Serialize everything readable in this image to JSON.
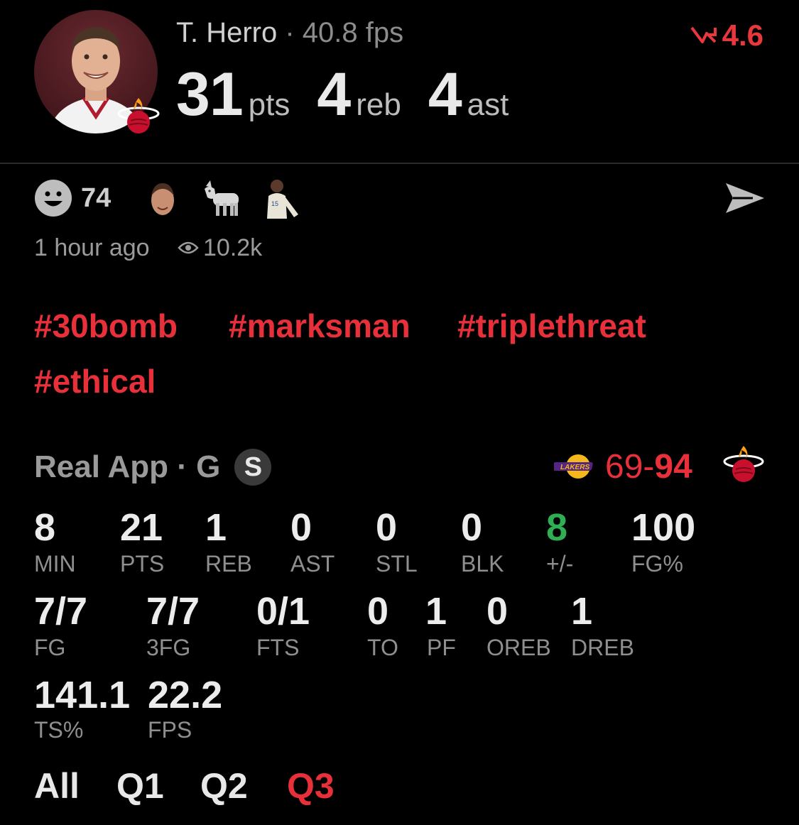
{
  "header": {
    "player_name": "T. Herro",
    "separator": " · ",
    "fps_text": "40.8 fps",
    "trend_value": "4.6",
    "stats": [
      {
        "value": "31",
        "unit": "pts"
      },
      {
        "value": "4",
        "unit": "reb"
      },
      {
        "value": "4",
        "unit": "ast"
      }
    ]
  },
  "reactions": {
    "count": "74",
    "time_ago": "1 hour ago",
    "views": "10.2k"
  },
  "tags": [
    "#30bomb",
    "#marksman",
    "#triplethreat",
    "#ethical"
  ],
  "game": {
    "label": "Real App · G",
    "badge": "S",
    "score_away": "69",
    "score_sep": "-",
    "score_home": "94"
  },
  "stats_row1": [
    {
      "value": "8",
      "label": "MIN"
    },
    {
      "value": "21",
      "label": "PTS"
    },
    {
      "value": "1",
      "label": "REB"
    },
    {
      "value": "0",
      "label": "AST"
    },
    {
      "value": "0",
      "label": "STL"
    },
    {
      "value": "0",
      "label": "BLK"
    },
    {
      "value": "8",
      "label": "+/-"
    },
    {
      "value": "100",
      "label": "FG%"
    }
  ],
  "stats_row2": [
    {
      "value": "7/7",
      "label": "FG"
    },
    {
      "value": "7/7",
      "label": "3FG"
    },
    {
      "value": "0/1",
      "label": "FTS"
    },
    {
      "value": "0",
      "label": "TO"
    },
    {
      "value": "1",
      "label": "PF"
    },
    {
      "value": "0",
      "label": "OREB"
    },
    {
      "value": "1",
      "label": "DREB"
    }
  ],
  "stats_row3": [
    {
      "value": "141.1",
      "label": "TS%"
    },
    {
      "value": "22.2",
      "label": "FPS"
    }
  ],
  "quarter_tabs": [
    "All",
    "Q1",
    "Q2",
    "Q3"
  ],
  "active_tab": "Q3",
  "colors": {
    "accent_red": "#e8303a",
    "positive_green": "#2fae55",
    "background": "#000000"
  },
  "icons": [
    "smile-icon",
    "send-icon",
    "eye-icon",
    "trend-down-icon",
    "heat-logo-icon",
    "lakers-logo-icon",
    "goat-emoji-icon"
  ]
}
